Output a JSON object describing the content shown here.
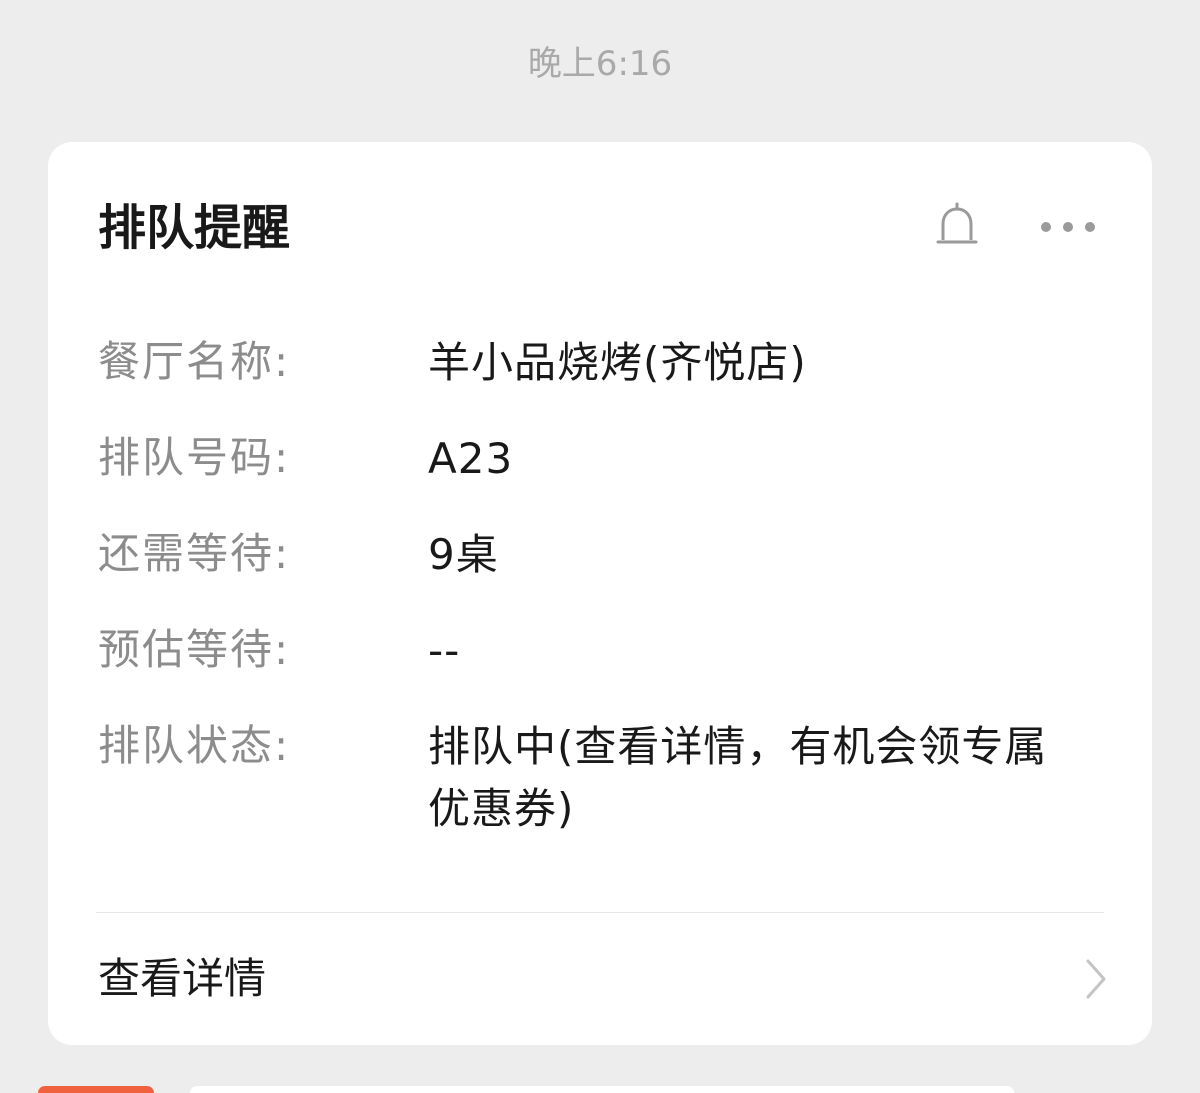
{
  "timestamp": "晚上6:16",
  "card": {
    "title": "排队提醒",
    "fields": [
      {
        "label": "餐厅名称:",
        "value": "羊小品烧烤(齐悦店)"
      },
      {
        "label": "排队号码:",
        "value": "A23"
      },
      {
        "label": "还需等待:",
        "value": "9桌"
      },
      {
        "label": "预估等待:",
        "value": "--"
      },
      {
        "label": "排队状态:",
        "value": "排队中(查看详情，有机会领专属优惠券)"
      }
    ],
    "details_label": "查看详情"
  },
  "icons": {
    "bell": "bell-icon",
    "more": "more-icon",
    "chevron": "chevron-right-icon"
  },
  "colors": {
    "background": "#ededed",
    "card": "#ffffff",
    "label": "#8c8c8c",
    "text": "#191919",
    "timestamp": "#a9a9a9",
    "accent": "#f0623e"
  }
}
